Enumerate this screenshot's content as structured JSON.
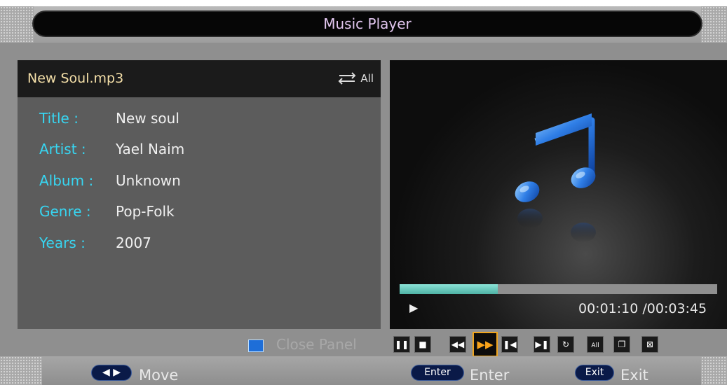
{
  "window": {
    "title": "Music Player"
  },
  "file": {
    "name": "New Soul.mp3",
    "repeat_mode": "All"
  },
  "info": [
    {
      "key": "Title :",
      "value": "New soul"
    },
    {
      "key": "Artist :",
      "value": "Yael Naim"
    },
    {
      "key": "Album :",
      "value": "Unknown"
    },
    {
      "key": "Genre :",
      "value": "Pop-Folk"
    },
    {
      "key": "Years :",
      "value": "2007"
    }
  ],
  "playback": {
    "state_icon": "play-icon",
    "time_display": "00:01:10 /00:03:45",
    "progress": 0.31
  },
  "panel": {
    "close_label": "Close Panel"
  },
  "controls": [
    {
      "name": "pause-button",
      "icon": "pause-icon"
    },
    {
      "name": "stop-button",
      "icon": "stop-icon"
    },
    {
      "name": "rewind-button",
      "icon": "rewind-icon"
    },
    {
      "name": "fast-forward-button",
      "icon": "fast-forward-icon",
      "selected": true
    },
    {
      "name": "previous-button",
      "icon": "skip-previous-icon"
    },
    {
      "name": "next-button",
      "icon": "skip-next-icon"
    },
    {
      "name": "repeat-button",
      "icon": "repeat-icon"
    },
    {
      "name": "repeat-all-button",
      "icon": "repeat-all-icon"
    },
    {
      "name": "playlist-button",
      "icon": "playlist-icon"
    },
    {
      "name": "close-button",
      "icon": "close-icon"
    }
  ],
  "footer": {
    "move_label": "Move",
    "enter_key": "Enter",
    "enter_label": "Enter",
    "exit_key": "Exit",
    "exit_label": "Exit"
  },
  "colors": {
    "accent": "#37d6f2",
    "file_name": "#f4dfa8",
    "selected": "#f0a51e",
    "progress": "#6fd0c4",
    "close_panel_key": "#1e6ed8"
  }
}
